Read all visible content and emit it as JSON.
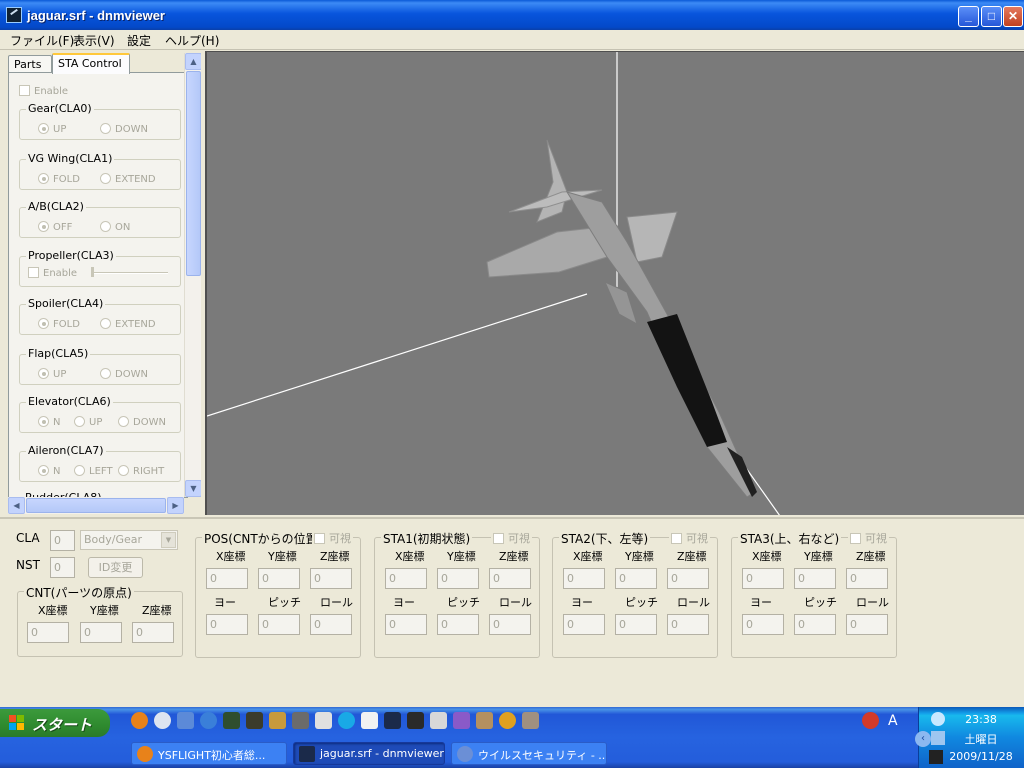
{
  "window": {
    "title": "jaguar.srf - dnmviewer",
    "minimize": "_",
    "maximize": "□",
    "close": "✕"
  },
  "menu": [
    "ファイル(F)",
    "表示(V)",
    "設定",
    "ヘルプ(H)"
  ],
  "tabs": [
    "Parts",
    "STA Control"
  ],
  "sta_control": {
    "enable_label": "Enable",
    "groups": [
      {
        "legend": "Gear(CLA0)",
        "options": [
          "UP",
          "DOWN"
        ],
        "selected": 0
      },
      {
        "legend": "VG Wing(CLA1)",
        "options": [
          "FOLD",
          "EXTEND"
        ],
        "selected": 0
      },
      {
        "legend": "A/B(CLA2)",
        "options": [
          "OFF",
          "ON"
        ],
        "selected": 0
      },
      {
        "legend": "Propeller(CLA3)",
        "enable": "Enable"
      },
      {
        "legend": "Spoiler(CLA4)",
        "options": [
          "FOLD",
          "EXTEND"
        ],
        "selected": 0
      },
      {
        "legend": "Flap(CLA5)",
        "options": [
          "UP",
          "DOWN"
        ],
        "selected": 0
      },
      {
        "legend": "Elevator(CLA6)",
        "options": [
          "N",
          "UP",
          "DOWN"
        ],
        "selected": 0
      },
      {
        "legend": "Aileron(CLA7)",
        "options": [
          "N",
          "LEFT",
          "RIGHT"
        ],
        "selected": 0
      },
      {
        "legend": "Rudder(CLA8)"
      }
    ]
  },
  "bottom": {
    "cla_label": "CLA",
    "cla_value": "0",
    "cla_combo": "Body/Gear",
    "nst_label": "NST",
    "nst_value": "0",
    "id_button": "ID変更",
    "cnt": {
      "legend": "CNT(パーツの原点)",
      "cols": [
        "X座標",
        "Y座標",
        "Z座標"
      ],
      "values": [
        "0",
        "0",
        "0"
      ]
    },
    "visible_label": "可視",
    "frames": [
      {
        "legend": "POS(CNTからの位置)"
      },
      {
        "legend": "STA1(初期状態)"
      },
      {
        "legend": "STA2(下、左等)"
      },
      {
        "legend": "STA3(上、右など)"
      }
    ],
    "pos_cols": [
      "X座標",
      "Y座標",
      "Z座標"
    ],
    "rot_cols": [
      "ヨー",
      "ピッチ",
      "ロール"
    ],
    "field_value": "0"
  },
  "taskbar": {
    "start_label": "スタート",
    "buttons": [
      {
        "label": "YSFLIGHT初心者総...",
        "color": "#e8821a"
      },
      {
        "label": "jaguar.srf - dnmviewer",
        "color": "#1b2a4a"
      },
      {
        "label": "ウイルスセキュリティ - ...",
        "color": "#6b8fd6"
      }
    ],
    "tray_lang": "A",
    "time": "23:38",
    "weekday": "土曜日",
    "date": "2009/11/28"
  },
  "colors": {
    "titlebar": "#0855dd",
    "viewport": "#7a7a7a",
    "face": "#ece9d8",
    "taskbar": "#245ddb",
    "start": "#3c9a3c"
  }
}
